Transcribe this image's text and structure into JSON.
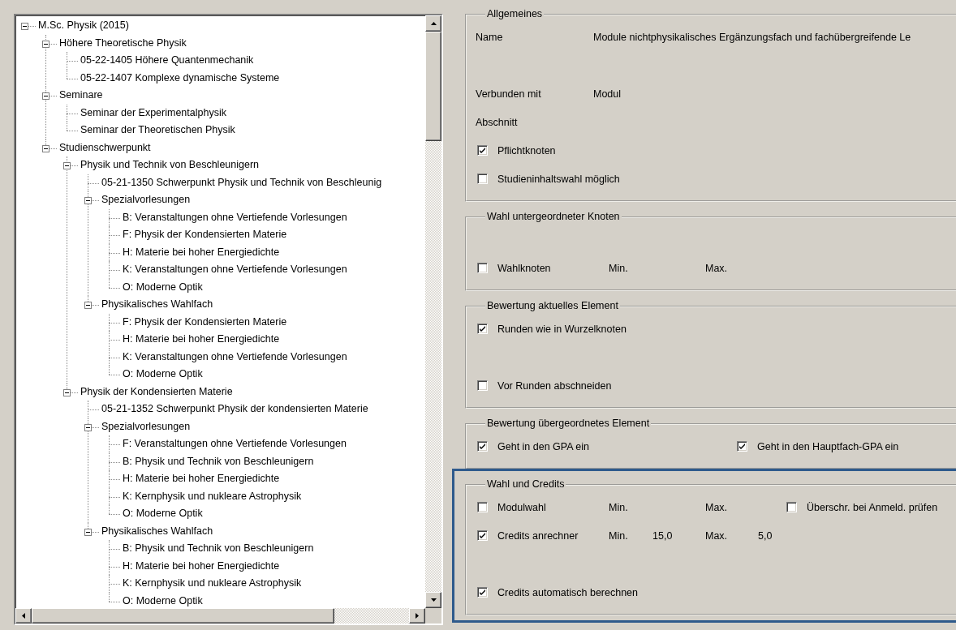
{
  "tree": {
    "items": [
      {
        "label": "M.Sc. Physik (2015)",
        "expanded": true,
        "children": [
          {
            "label": "Höhere Theoretische Physik",
            "expanded": true,
            "children": [
              {
                "label": "05-22-1405 Höhere Quantenmechanik"
              },
              {
                "label": "05-22-1407 Komplexe dynamische Systeme"
              }
            ]
          },
          {
            "label": "Seminare",
            "expanded": true,
            "children": [
              {
                "label": "Seminar der Experimentalphysik"
              },
              {
                "label": "Seminar der Theoretischen Physik"
              }
            ]
          },
          {
            "label": "Studienschwerpunkt",
            "expanded": true,
            "children": [
              {
                "label": "Physik und Technik von Beschleunigern",
                "expanded": true,
                "children": [
                  {
                    "label": "05-21-1350 Schwerpunkt Physik und Technik von Beschleunig"
                  },
                  {
                    "label": "Spezialvorlesungen",
                    "expanded": true,
                    "children": [
                      {
                        "label": "B: Veranstaltungen ohne Vertiefende Vorlesungen"
                      },
                      {
                        "label": "F: Physik der Kondensierten Materie"
                      },
                      {
                        "label": "H: Materie bei hoher Energiedichte"
                      },
                      {
                        "label": "K: Veranstaltungen ohne Vertiefende Vorlesungen"
                      },
                      {
                        "label": "O: Moderne Optik"
                      }
                    ]
                  },
                  {
                    "label": "Physikalisches Wahlfach",
                    "expanded": true,
                    "children": [
                      {
                        "label": "F: Physik der Kondensierten Materie"
                      },
                      {
                        "label": "H: Materie bei hoher Energiedichte"
                      },
                      {
                        "label": "K: Veranstaltungen ohne Vertiefende Vorlesungen"
                      },
                      {
                        "label": "O: Moderne Optik"
                      }
                    ]
                  }
                ]
              },
              {
                "label": "Physik der Kondensierten Materie",
                "expanded": true,
                "children": [
                  {
                    "label": "05-21-1352 Schwerpunkt Physik der kondensierten Materie"
                  },
                  {
                    "label": "Spezialvorlesungen",
                    "expanded": true,
                    "children": [
                      {
                        "label": "F: Veranstaltungen ohne Vertiefende Vorlesungen"
                      },
                      {
                        "label": "B: Physik und Technik von Beschleunigern"
                      },
                      {
                        "label": "H: Materie bei hoher Energiedichte"
                      },
                      {
                        "label": "K: Kernphysik und nukleare Astrophysik"
                      },
                      {
                        "label": "O: Moderne Optik"
                      }
                    ]
                  },
                  {
                    "label": "Physikalisches Wahlfach",
                    "expanded": true,
                    "children": [
                      {
                        "label": "B: Physik und Technik von Beschleunigern"
                      },
                      {
                        "label": "H: Materie bei hoher Energiedichte"
                      },
                      {
                        "label": "K: Kernphysik und nukleare Astrophysik"
                      },
                      {
                        "label": "O: Moderne Optik"
                      }
                    ]
                  }
                ]
              }
            ]
          }
        ]
      }
    ]
  },
  "groups": [
    {
      "title": "Allgemeines",
      "highlighted": false,
      "rows": [
        {
          "kind": "field",
          "label": "Name",
          "value": "Module nichtphysikalisches Ergänzungsfach und fachübergreifende Le"
        },
        {
          "kind": "blank"
        },
        {
          "kind": "field",
          "label": "Verbunden mit",
          "value": "Modul"
        },
        {
          "kind": "field",
          "label": "Abschnitt"
        },
        {
          "kind": "check",
          "check": {
            "label": "Pflichtknoten",
            "checked": true
          }
        },
        {
          "kind": "check",
          "check": {
            "label": "Studieninhaltswahl möglich",
            "checked": false
          }
        }
      ]
    },
    {
      "title": "Wahl untergeordneter Knoten",
      "highlighted": false,
      "rows": [
        {
          "kind": "blank"
        },
        {
          "kind": "range",
          "check": {
            "label": "Wahlknoten",
            "checked": false
          },
          "min_label": "Min.",
          "max_label": "Max."
        }
      ]
    },
    {
      "title": "Bewertung aktuelles Element",
      "highlighted": false,
      "rows": [
        {
          "kind": "check",
          "check": {
            "label": "Runden wie in Wurzelknoten",
            "checked": true
          }
        },
        {
          "kind": "blank"
        },
        {
          "kind": "check",
          "check": {
            "label": "Vor Runden abschneiden",
            "checked": false
          }
        }
      ]
    },
    {
      "title": "Bewertung übergeordnetes Element",
      "highlighted": false,
      "rows": [
        {
          "kind": "pair",
          "check": {
            "label": "Geht in den GPA ein",
            "checked": true
          },
          "option": {
            "label": "Geht in den Hauptfach-GPA ein",
            "checked": true
          }
        }
      ]
    },
    {
      "title": "Wahl und Credits",
      "highlighted": true,
      "rows": [
        {
          "kind": "range",
          "check": {
            "label": "Modulwahl",
            "checked": false
          },
          "min_label": "Min.",
          "max_label": "Max.",
          "option": {
            "label": "Überschr. bei Anmeld. prüfen",
            "checked": false
          }
        },
        {
          "kind": "range",
          "check": {
            "label": "Credits anrechner",
            "checked": true
          },
          "min_label": "Min.",
          "min_value": "15,0",
          "max_label": "Max.",
          "max_value": "5,0"
        },
        {
          "kind": "blank"
        },
        {
          "kind": "check",
          "check": {
            "label": "Credits automatisch berechnen",
            "checked": true
          }
        }
      ]
    }
  ]
}
